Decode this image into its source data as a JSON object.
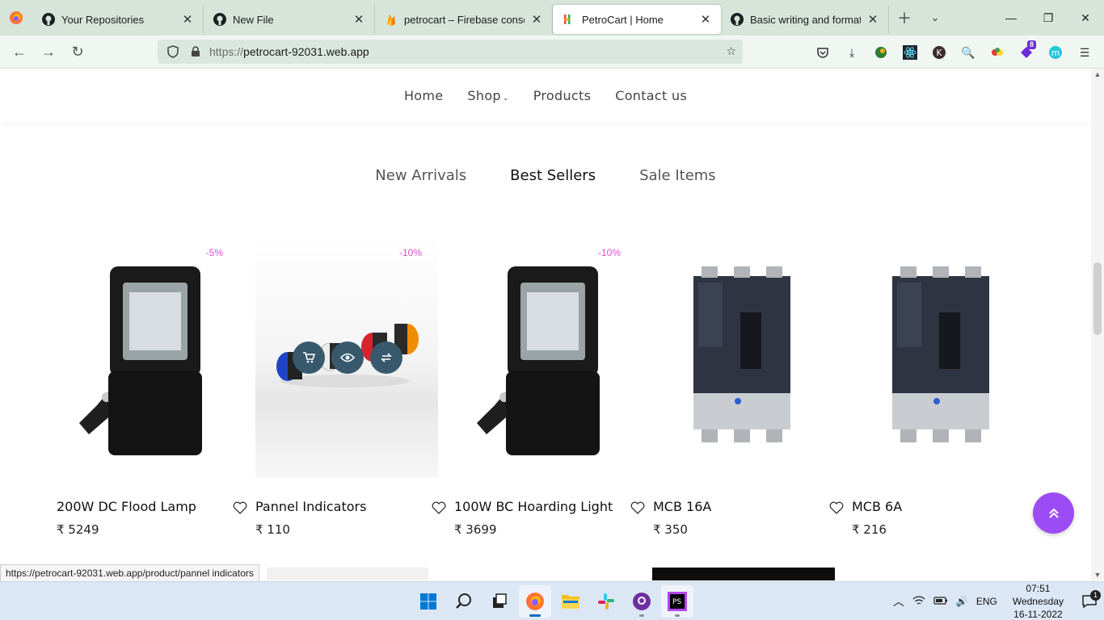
{
  "browser": {
    "tabs": [
      {
        "title": "Your Repositories",
        "icon": "github-icon"
      },
      {
        "title": "New File",
        "icon": "github-icon"
      },
      {
        "title": "petrocart – Firebase console",
        "icon": "firebase-icon"
      },
      {
        "title": "PetroCart | Home",
        "icon": "petrocart-icon",
        "active": true
      },
      {
        "title": "Basic writing and formatting",
        "icon": "github-icon"
      }
    ],
    "url_scheme": "https://",
    "url_host": "petrocart-92031.web.app",
    "extension_badge": "8",
    "status_url": "https://petrocart-92031.web.app/product/pannel indicators"
  },
  "site": {
    "nav": [
      "Home",
      "Shop",
      "Products",
      "Contact us"
    ],
    "tabs": [
      "New Arrivals",
      "Best Sellers",
      "Sale Items"
    ],
    "active_tab": "Best Sellers",
    "products": [
      {
        "name": "200W DC Flood Lamp",
        "price": "₹ 5249",
        "discount": "-5%",
        "image": "flood-lamp"
      },
      {
        "name": "Pannel Indicators",
        "price": "₹ 110",
        "discount": "-10%",
        "image": "panel-indicators"
      },
      {
        "name": "100W BC Hoarding Light",
        "price": "₹ 3699",
        "discount": "-10%",
        "image": "flood-lamp"
      },
      {
        "name": "MCB 16A",
        "price": "₹ 350",
        "discount": "",
        "image": "mcb"
      },
      {
        "name": "MCB 6A",
        "price": "₹ 216",
        "discount": "",
        "image": "mcb"
      }
    ],
    "colors": {
      "accent": "#9d4cf5",
      "discount": "#e04bd8",
      "action": "#37596b"
    }
  },
  "taskbar": {
    "language": "ENG",
    "time": "07:51",
    "day": "Wednesday",
    "date": "16-11-2022",
    "notification_count": "1"
  }
}
